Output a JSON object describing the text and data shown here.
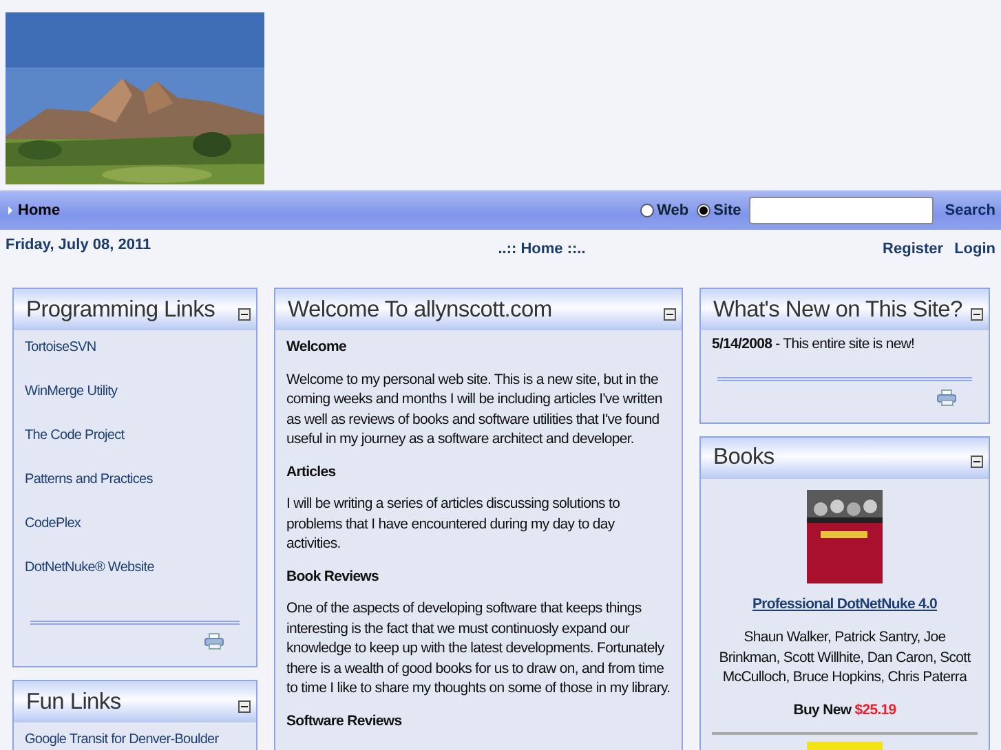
{
  "nav": {
    "menu": [
      {
        "label": "Home",
        "selected": true
      }
    ],
    "search": {
      "options": [
        {
          "label": "Web",
          "selected": false
        },
        {
          "label": "Site",
          "selected": true
        }
      ],
      "button": "Search"
    }
  },
  "info_bar": {
    "date": "Friday, July 08, 2011",
    "breadcrumb": "..:: Home ::..",
    "links": [
      "Register",
      "Login"
    ]
  },
  "columns": [
    [
      {
        "kind": "links",
        "title": "Programming Links",
        "items": [
          "TortoiseSVN",
          "WinMerge Utility",
          "The Code Project",
          "Patterns and Practices",
          "CodePlex",
          "DotNetNuke® Website"
        ],
        "print": true
      },
      {
        "kind": "links",
        "title": "Fun Links",
        "items": [
          "Google Transit for Denver-Boulder"
        ],
        "print": false
      }
    ],
    [
      {
        "kind": "text",
        "title": "Welcome To allynscott.com",
        "sections": [
          {
            "heading": "Welcome",
            "body": "Welcome to my personal web site. This is a new site, but in the coming weeks and months I will be including articles I've written as well as reviews of books and software utilities that I've found useful in my journey as a software architect and developer."
          },
          {
            "heading": "Articles",
            "body": "I will be writing a series of articles discussing solutions to problems that I have encountered during my day to day activities."
          },
          {
            "heading": "Book Reviews",
            "body": "One of the aspects of developing software that keeps things interesting is the fact that we must continuosly expand our knowledge to keep up with the latest developments. Fortunately there is a wealth of good books for us to draw on, and from time to time I like to share my thoughts on some of those in my library."
          },
          {
            "heading": "Software Reviews"
          }
        ],
        "print": false
      }
    ],
    [
      {
        "kind": "news",
        "title": "What's New on This Site?",
        "items": [
          "**5/14/2008** - This entire site is new!"
        ],
        "print": true
      },
      {
        "kind": "book",
        "title": "Books",
        "book_title": "Professional DotNetNuke 4.0",
        "authors": "Shaun Walker, Patrick Santry, Joe Brinkman, Scott Willhite, Dan Caron, Scott McCulloch, Bruce Hopkins, Chris Paterra",
        "buy_label": "Buy New",
        "price": "$25.19",
        "print": false
      }
    ]
  ]
}
